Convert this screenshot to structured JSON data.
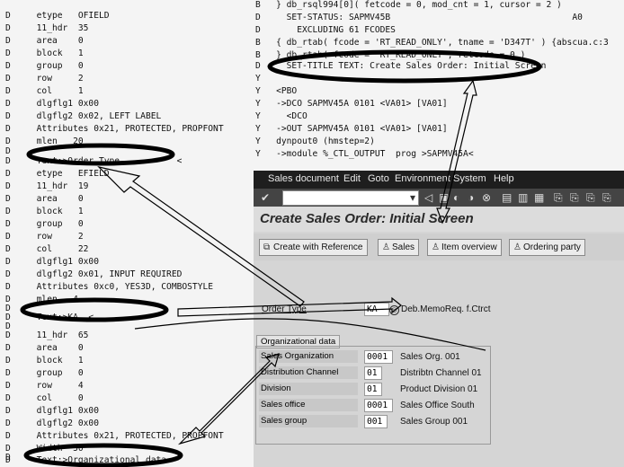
{
  "left_trace": [
    "D     etype   OFIELD",
    "D     11_hdr  35",
    "D     area    0",
    "D     block   1",
    "D     group   0",
    "D     row     2",
    "D     col     1",
    "D     dlgflg1 0x00",
    "D     dlgflg2 0x02, LEFT LABEL",
    "D     Attributes 0x21, PROTECTED, PROPFONT",
    "D     mlen   20",
    "D",
    "D     Text:>Order Type           <",
    "D     etype   EFIELD",
    "D     11_hdr  19",
    "D     area    0",
    "D     block   1",
    "D     group   0",
    "D     row     2",
    "D     col     22",
    "D     dlgflg1 0x00",
    "D     dlgflg2 0x01, INPUT REQUIRED",
    "D     Attributes 0xc0, YES3D, COMBOSTYLE",
    "D     mlen   4",
    "D",
    "D     Text:>KA  <",
    "D",
    "D     11_hdr  65",
    "D     area    0",
    "D     block   1",
    "D     group   0",
    "D     row     4",
    "D     col     0",
    "D     dlgflg1 0x00",
    "D     dlgflg2 0x00",
    "D     Attributes 0x21, PROTECTED, PROPFONT",
    "D     Width  50",
    "D",
    "D     Text:>Organizational data"
  ],
  "top_trace": [
    "B   } db_rsql994[0]( fetcode = 0, mod_cnt = 1, cursor = 2 )",
    "D     SET-STATUS: SAPMV45B                                   A0",
    "D       EXCLUDING 61 FCODES",
    "B   { db_rtab( fcode = 'RT_READ_ONLY', tname = 'D347T' ) {abscua.c:3",
    "B   } db_rtab( fcode = 'RT_READ_ONLY', retcode = 0 )",
    "D     SET-TITLE TEXT: Create Sales Order: Initial Screen",
    "Y",
    "Y   <PBO",
    "Y   ->DCO SAPMV45A 0101 <VA01> [VA01]",
    "Y     <DCO",
    "Y   ->OUT SAPMV45A 0101 <VA01> [VA01]",
    "Y   dynpout0 (hmstep=2)",
    "Y   ->module %_CTL_OUTPUT  prog >SAPMV45A<"
  ],
  "menu": [
    "Sales document",
    "Edit",
    "Goto",
    "Environment",
    "System",
    "Help"
  ],
  "screen_title": "Create Sales Order: Initial Screen",
  "app_buttons": {
    "create_with_reference": "Create with Reference",
    "sales": "Sales",
    "item_overview": "Item overview",
    "ordering_party": "Ordering party"
  },
  "order_type": {
    "label": "Order Type",
    "value": "KA",
    "description": "Deb.MemoReq. f.Ctrct"
  },
  "org_group_title": "Organizational data",
  "org_fields": [
    {
      "label": "Sales Organization",
      "value": "0001",
      "description": "Sales Org. 001"
    },
    {
      "label": "Distribution Channel",
      "value": "01",
      "description": "Distribtn Channel 01"
    },
    {
      "label": "Division",
      "value": "01",
      "description": "Product Division 01"
    },
    {
      "label": "Sales office",
      "value": "0001",
      "description": "Sales Office South"
    },
    {
      "label": "Sales group",
      "value": "001",
      "description": "Sales Group 001"
    }
  ]
}
